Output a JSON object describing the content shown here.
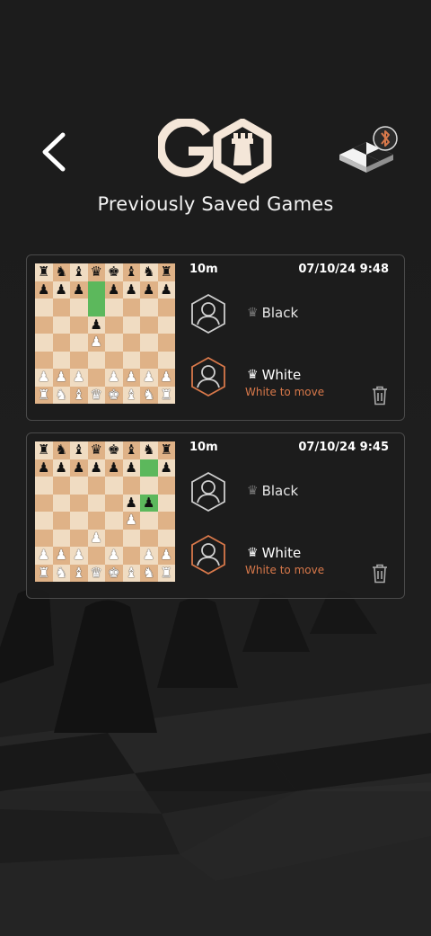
{
  "header": {
    "title": "Previously Saved Games",
    "back_icon": "chevron-left-icon",
    "logo_icon": "go-chess-logo-icon",
    "board_icon": "chessboard-bluetooth-icon"
  },
  "colors": {
    "background": "#1c1c1c",
    "accent": "#d8784a",
    "highlight": "#5cb85c",
    "light_square": "#f0dcc2",
    "dark_square": "#dfb287"
  },
  "games": [
    {
      "time_control": "10m",
      "date": "07/10/24 9:48",
      "black_player": "Black",
      "white_player": "White",
      "status": "White to move",
      "highlight": [
        [
          1,
          3
        ],
        [
          2,
          3
        ]
      ],
      "position": [
        "rnbqkbnr",
        "ppp.pppp",
        "........",
        "...p....",
        "...P....",
        "........",
        "PPP.PPPP",
        "RNBQKBNR"
      ]
    },
    {
      "time_control": "10m",
      "date": "07/10/24 9:45",
      "black_player": "Black",
      "white_player": "White",
      "status": "White to move",
      "highlight": [
        [
          1,
          6
        ],
        [
          3,
          6
        ]
      ],
      "position": [
        "rnbqkbnr",
        "pppppp.p",
        "........",
        ".....pp.",
        ".....P..",
        "...P....",
        "PPP.P.PP",
        "RNBQKBNR"
      ]
    }
  ]
}
